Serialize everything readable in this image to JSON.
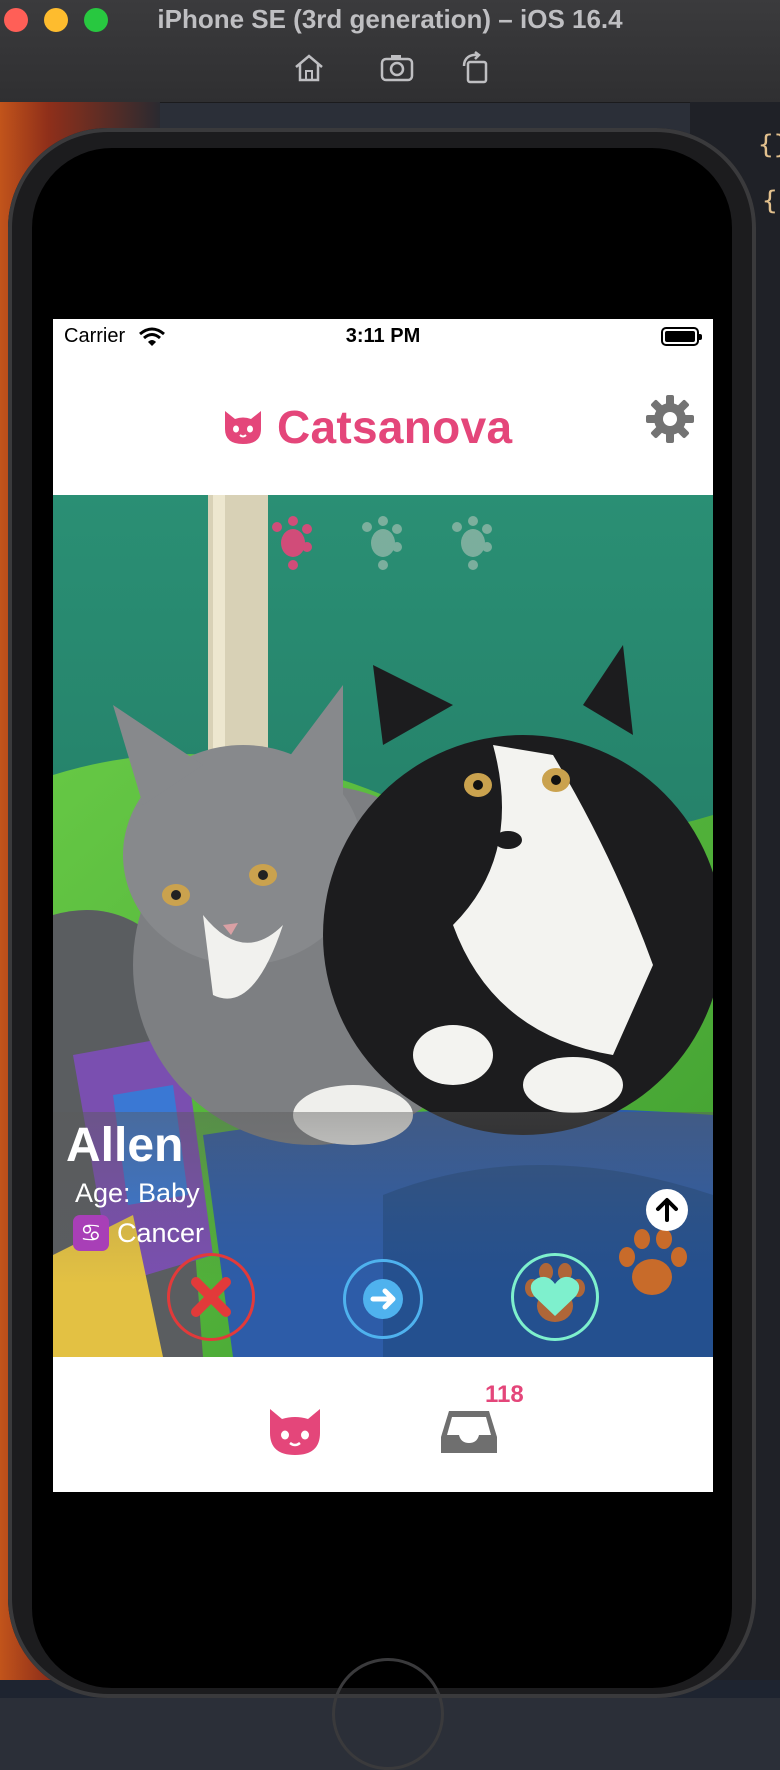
{
  "simulator": {
    "title": "iPhone SE (3rd generation) – iOS 16.4",
    "toolbar": [
      "home-icon",
      "screenshot-icon",
      "rotate-icon"
    ]
  },
  "status_bar": {
    "carrier": "Carrier",
    "time": "3:11 PM"
  },
  "app": {
    "title": "Catsanova",
    "accent_color": "#e4467a",
    "logo_icon": "cat-face-icon",
    "settings_icon": "gear-icon"
  },
  "card": {
    "photo_progress": {
      "total": 3,
      "active": 1
    },
    "name": "Allen",
    "age_label": "Age: Baby",
    "zodiac_symbol": "♋",
    "zodiac_label": "Cancer",
    "actions": {
      "nope_icon": "x-icon",
      "next_icon": "arrow-right-icon",
      "like_icon": "heart-icon",
      "details_icon": "arrow-up-icon"
    }
  },
  "tab_bar": {
    "cats_icon": "cat-face-icon",
    "inbox_icon": "inbox-icon",
    "inbox_badge": "118"
  }
}
